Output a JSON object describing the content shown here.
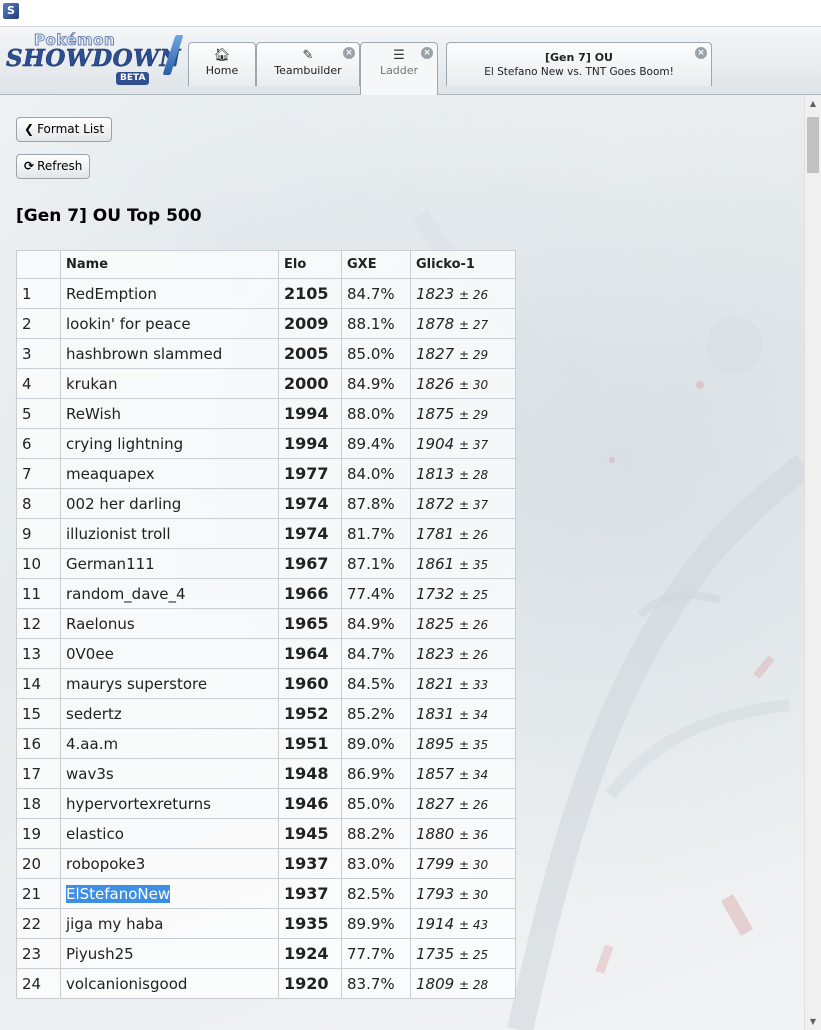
{
  "logo": {
    "pokemon": "Pokémon",
    "showdown": "SHOWDOWN",
    "beta": "BETA"
  },
  "tabs": [
    {
      "icon": "home-icon",
      "label": "Home"
    },
    {
      "icon": "edit-icon",
      "label": "Teambuilder"
    },
    {
      "icon": "list-icon",
      "label": "Ladder"
    }
  ],
  "battle_tab": {
    "title": "[Gen 7] OU",
    "subtitle": "El Stefano New vs. TNT Goes Boom!"
  },
  "buttons": {
    "format_list": "Format List",
    "refresh": "Refresh"
  },
  "heading": "[Gen 7] OU Top 500",
  "columns": [
    "",
    "Name",
    "Elo",
    "GXE",
    "Glicko-1"
  ],
  "rows": [
    {
      "rank": "1",
      "name": "RedEmption",
      "elo": "2105",
      "gxe": "84.7%",
      "glicko": "1823",
      "dev": "± 26"
    },
    {
      "rank": "2",
      "name": "lookin' for peace",
      "elo": "2009",
      "gxe": "88.1%",
      "glicko": "1878",
      "dev": "± 27"
    },
    {
      "rank": "3",
      "name": "hashbrown slammed",
      "elo": "2005",
      "gxe": "85.0%",
      "glicko": "1827",
      "dev": "± 29"
    },
    {
      "rank": "4",
      "name": "krukan",
      "elo": "2000",
      "gxe": "84.9%",
      "glicko": "1826",
      "dev": "± 30"
    },
    {
      "rank": "5",
      "name": "ReWish",
      "elo": "1994",
      "gxe": "88.0%",
      "glicko": "1875",
      "dev": "± 29"
    },
    {
      "rank": "6",
      "name": "crying lightning",
      "elo": "1994",
      "gxe": "89.4%",
      "glicko": "1904",
      "dev": "± 37"
    },
    {
      "rank": "7",
      "name": "meaquapex",
      "elo": "1977",
      "gxe": "84.0%",
      "glicko": "1813",
      "dev": "± 28"
    },
    {
      "rank": "8",
      "name": "002 her darling",
      "elo": "1974",
      "gxe": "87.8%",
      "glicko": "1872",
      "dev": "± 37"
    },
    {
      "rank": "9",
      "name": "illuzionist troll",
      "elo": "1974",
      "gxe": "81.7%",
      "glicko": "1781",
      "dev": "± 26"
    },
    {
      "rank": "10",
      "name": "German111",
      "elo": "1967",
      "gxe": "87.1%",
      "glicko": "1861",
      "dev": "± 35"
    },
    {
      "rank": "11",
      "name": "random_dave_4",
      "elo": "1966",
      "gxe": "77.4%",
      "glicko": "1732",
      "dev": "± 25"
    },
    {
      "rank": "12",
      "name": "Raelonus",
      "elo": "1965",
      "gxe": "84.9%",
      "glicko": "1825",
      "dev": "± 26"
    },
    {
      "rank": "13",
      "name": "0V0ee",
      "elo": "1964",
      "gxe": "84.7%",
      "glicko": "1823",
      "dev": "± 26"
    },
    {
      "rank": "14",
      "name": "maurys superstore",
      "elo": "1960",
      "gxe": "84.5%",
      "glicko": "1821",
      "dev": "± 33"
    },
    {
      "rank": "15",
      "name": "sedertz",
      "elo": "1952",
      "gxe": "85.2%",
      "glicko": "1831",
      "dev": "± 34"
    },
    {
      "rank": "16",
      "name": "4.aa.m",
      "elo": "1951",
      "gxe": "89.0%",
      "glicko": "1895",
      "dev": "± 35"
    },
    {
      "rank": "17",
      "name": "wav3s",
      "elo": "1948",
      "gxe": "86.9%",
      "glicko": "1857",
      "dev": "± 34"
    },
    {
      "rank": "18",
      "name": "hypervortexreturns",
      "elo": "1946",
      "gxe": "85.0%",
      "glicko": "1827",
      "dev": "± 26"
    },
    {
      "rank": "19",
      "name": "elastico",
      "elo": "1945",
      "gxe": "88.2%",
      "glicko": "1880",
      "dev": "± 36"
    },
    {
      "rank": "20",
      "name": "robopoke3",
      "elo": "1937",
      "gxe": "83.0%",
      "glicko": "1799",
      "dev": "± 30"
    },
    {
      "rank": "21",
      "name": "ElStefanoNew",
      "elo": "1937",
      "gxe": "82.5%",
      "glicko": "1793",
      "dev": "± 30",
      "highlighted": true
    },
    {
      "rank": "22",
      "name": "jiga my haba",
      "elo": "1935",
      "gxe": "89.9%",
      "glicko": "1914",
      "dev": "± 43"
    },
    {
      "rank": "23",
      "name": "Piyush25",
      "elo": "1924",
      "gxe": "77.7%",
      "glicko": "1735",
      "dev": "± 25"
    },
    {
      "rank": "24",
      "name": "volcanionisgood",
      "elo": "1920",
      "gxe": "83.7%",
      "glicko": "1809",
      "dev": "± 28"
    }
  ],
  "colors": {
    "highlight": "#3d8fe3",
    "brand": "#2c4f94"
  }
}
